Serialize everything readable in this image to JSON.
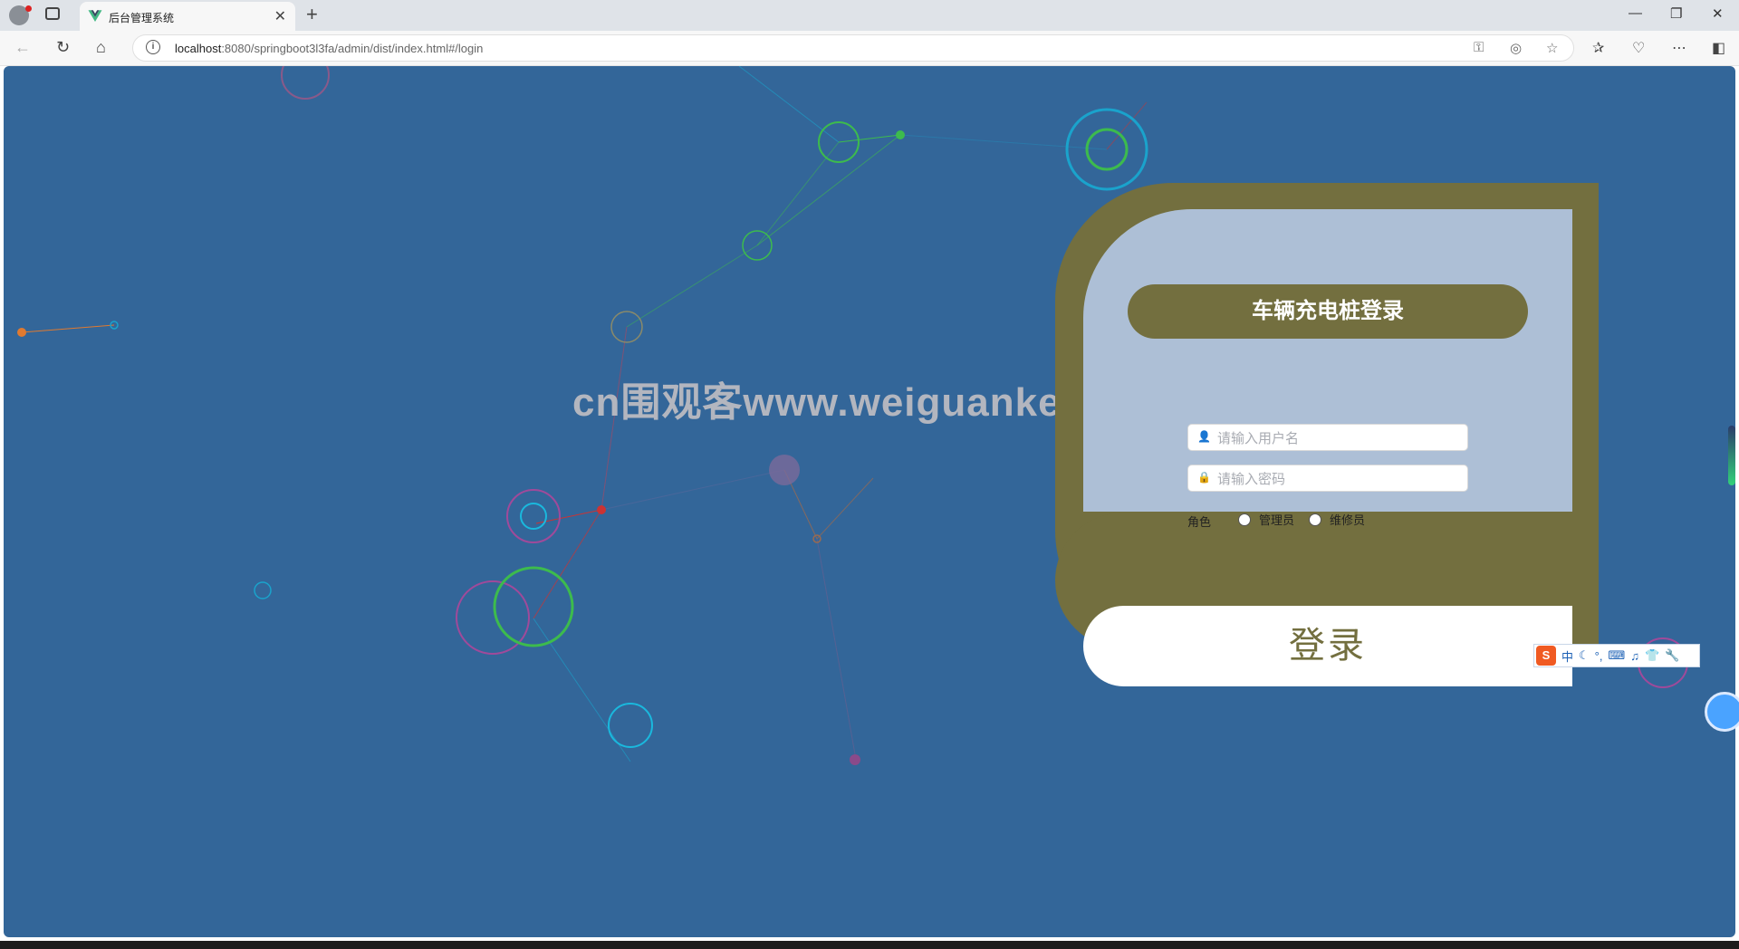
{
  "browser": {
    "tab_title": "后台管理系统",
    "address_host": "localhost",
    "address_rest": ":8080/springboot3l3fa/admin/dist/index.html#/login"
  },
  "watermark": "cn围观客www.weiguanke.cn",
  "login": {
    "title": "车辆充电桩登录",
    "username_placeholder": "请输入用户名",
    "password_placeholder": "请输入密码",
    "role_label": "角色",
    "roles": [
      "管理员",
      "维修员"
    ],
    "submit_label": "登录"
  },
  "ime": {
    "mode": "中"
  },
  "colors": {
    "page_background": "#336699",
    "panel_olive": "#736f3f",
    "panel_light": "#adbfd6"
  }
}
